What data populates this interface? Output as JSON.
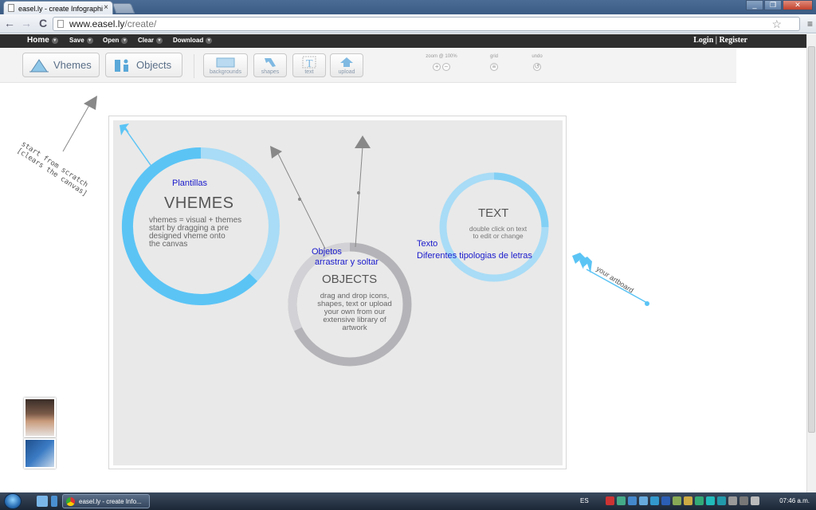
{
  "browser": {
    "tab_title": "easel.ly - create Infographi",
    "tab_close": "×",
    "url_host": "www.easel.ly",
    "url_path": "/create/",
    "back": "←",
    "forward": "→",
    "reload": "C",
    "star": "☆",
    "menu": "≡"
  },
  "site_nav": {
    "home": "Home",
    "save": "Save",
    "open": "Open",
    "clear": "Clear",
    "download": "Download",
    "auth": "Login  | Register"
  },
  "tools": {
    "vhemes": "Vhemes",
    "objects": "Objects",
    "backgrounds": "backgrounds",
    "shapes": "shapes",
    "text": "text",
    "upload": "upload",
    "zoom": "zoom @ 100%",
    "grid": "grid",
    "undo": "undo",
    "zoom_in": "+",
    "zoom_out": "−"
  },
  "canvas": {
    "vhemes_title": "VHEMES",
    "vhemes_desc": "vhemes = visual + themes\nstart by dragging a pre\ndesigned vheme onto\nthe canvas",
    "objects_title": "OBJECTS",
    "objects_desc": "drag and drop icons,\nshapes, text or upload\nyour own from our\nextensive library of\nartwork",
    "text_title": "TEXT",
    "text_desc": "double click on text\nto edit or change",
    "ann_plantillas": "Plantillas",
    "ann_objetos": "Objetos",
    "ann_arrastrar": "arrastrar y soltar",
    "ann_texto": "Texto",
    "ann_tipologias": "Diferentes tipologias de letras"
  },
  "hints": {
    "scratch": "start from scratch\n[clears the canvas]",
    "artboard": "your artboard"
  },
  "taskbar": {
    "task_label": "easel.ly - create Info...",
    "lang": "ES",
    "clock": "07:46 a.m."
  },
  "colors": {
    "accent_blue": "#5bc4f5",
    "light_blue": "#a9dcf6",
    "annotation": "#1a1acc",
    "grey_ring": "#b4b4b8"
  }
}
